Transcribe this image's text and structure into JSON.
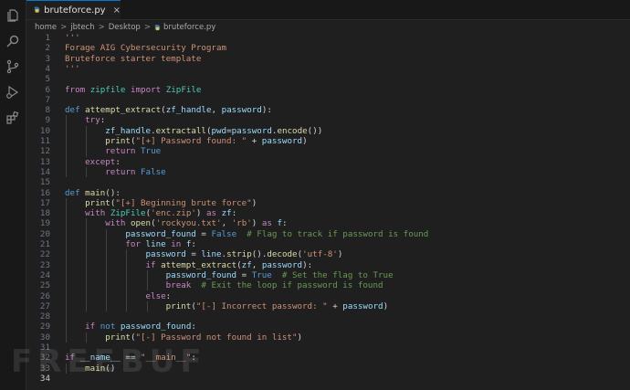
{
  "tab": {
    "label": "bruteforce.py",
    "close": "×"
  },
  "breadcrumb": [
    "home",
    "jbtech",
    "Desktop",
    "bruteforce.py"
  ],
  "breadcrumb_sep": ">",
  "activity_icons": [
    "files-icon",
    "search-icon",
    "source-control-icon",
    "run-debug-icon",
    "extensions-icon"
  ],
  "code_lines": [
    [
      [
        "t-docstr",
        "'''"
      ]
    ],
    [
      [
        "t-docstr",
        "Forage AIG Cybersecurity Program"
      ]
    ],
    [
      [
        "t-docstr",
        "Bruteforce starter template"
      ]
    ],
    [
      [
        "t-docstr",
        "'''"
      ]
    ],
    [],
    [
      [
        "t-kw",
        "from"
      ],
      [
        "t-plain",
        " "
      ],
      [
        "t-cls",
        "zipfile"
      ],
      [
        "t-plain",
        " "
      ],
      [
        "t-kw",
        "import"
      ],
      [
        "t-plain",
        " "
      ],
      [
        "t-cls",
        "ZipFile"
      ]
    ],
    [],
    [
      [
        "t-kw2",
        "def"
      ],
      [
        "t-plain",
        " "
      ],
      [
        "t-fn",
        "attempt_extract"
      ],
      [
        "t-plain",
        "("
      ],
      [
        "t-var",
        "zf_handle"
      ],
      [
        "t-plain",
        ", "
      ],
      [
        "t-var",
        "password"
      ],
      [
        "t-plain",
        "):"
      ]
    ],
    [
      [
        "t-plain",
        "    "
      ],
      [
        "t-kw",
        "try"
      ],
      [
        "t-plain",
        ":"
      ]
    ],
    [
      [
        "t-plain",
        "        "
      ],
      [
        "t-var",
        "zf_handle"
      ],
      [
        "t-plain",
        "."
      ],
      [
        "t-fn",
        "extractall"
      ],
      [
        "t-plain",
        "("
      ],
      [
        "t-var",
        "pwd"
      ],
      [
        "t-plain",
        "="
      ],
      [
        "t-var",
        "password"
      ],
      [
        "t-plain",
        "."
      ],
      [
        "t-fn",
        "encode"
      ],
      [
        "t-plain",
        "())"
      ]
    ],
    [
      [
        "t-plain",
        "        "
      ],
      [
        "t-fn",
        "print"
      ],
      [
        "t-plain",
        "("
      ],
      [
        "t-str",
        "\"[+] Password found: \""
      ],
      [
        "t-plain",
        " + "
      ],
      [
        "t-var",
        "password"
      ],
      [
        "t-plain",
        ")"
      ]
    ],
    [
      [
        "t-plain",
        "        "
      ],
      [
        "t-kw",
        "return"
      ],
      [
        "t-plain",
        " "
      ],
      [
        "t-kw2",
        "True"
      ]
    ],
    [
      [
        "t-plain",
        "    "
      ],
      [
        "t-kw",
        "except"
      ],
      [
        "t-plain",
        ":"
      ]
    ],
    [
      [
        "t-plain",
        "        "
      ],
      [
        "t-kw",
        "return"
      ],
      [
        "t-plain",
        " "
      ],
      [
        "t-kw2",
        "False"
      ]
    ],
    [],
    [
      [
        "t-kw2",
        "def"
      ],
      [
        "t-plain",
        " "
      ],
      [
        "t-fn",
        "main"
      ],
      [
        "t-plain",
        "():"
      ]
    ],
    [
      [
        "t-plain",
        "    "
      ],
      [
        "t-fn",
        "print"
      ],
      [
        "t-plain",
        "("
      ],
      [
        "t-str",
        "\"[+] Beginning brute force\""
      ],
      [
        "t-plain",
        ")"
      ]
    ],
    [
      [
        "t-plain",
        "    "
      ],
      [
        "t-kw",
        "with"
      ],
      [
        "t-plain",
        " "
      ],
      [
        "t-cls",
        "ZipFile"
      ],
      [
        "t-plain",
        "("
      ],
      [
        "t-str",
        "'enc.zip'"
      ],
      [
        "t-plain",
        ") "
      ],
      [
        "t-kw",
        "as"
      ],
      [
        "t-plain",
        " "
      ],
      [
        "t-var",
        "zf"
      ],
      [
        "t-plain",
        ":"
      ]
    ],
    [
      [
        "t-plain",
        "        "
      ],
      [
        "t-kw",
        "with"
      ],
      [
        "t-plain",
        " "
      ],
      [
        "t-fn",
        "open"
      ],
      [
        "t-plain",
        "("
      ],
      [
        "t-str",
        "'rockyou.txt'"
      ],
      [
        "t-plain",
        ", "
      ],
      [
        "t-str",
        "'rb'"
      ],
      [
        "t-plain",
        ") "
      ],
      [
        "t-kw",
        "as"
      ],
      [
        "t-plain",
        " "
      ],
      [
        "t-var",
        "f"
      ],
      [
        "t-plain",
        ":"
      ]
    ],
    [
      [
        "t-plain",
        "            "
      ],
      [
        "t-var",
        "password_found"
      ],
      [
        "t-plain",
        " = "
      ],
      [
        "t-kw2",
        "False"
      ],
      [
        "t-plain",
        "  "
      ],
      [
        "t-com",
        "# Flag to track if password is found"
      ]
    ],
    [
      [
        "t-plain",
        "            "
      ],
      [
        "t-kw",
        "for"
      ],
      [
        "t-plain",
        " "
      ],
      [
        "t-var",
        "line"
      ],
      [
        "t-plain",
        " "
      ],
      [
        "t-kw",
        "in"
      ],
      [
        "t-plain",
        " "
      ],
      [
        "t-var",
        "f"
      ],
      [
        "t-plain",
        ":"
      ]
    ],
    [
      [
        "t-plain",
        "                "
      ],
      [
        "t-var",
        "password"
      ],
      [
        "t-plain",
        " = "
      ],
      [
        "t-var",
        "line"
      ],
      [
        "t-plain",
        "."
      ],
      [
        "t-fn",
        "strip"
      ],
      [
        "t-plain",
        "()."
      ],
      [
        "t-fn",
        "decode"
      ],
      [
        "t-plain",
        "("
      ],
      [
        "t-str",
        "'utf-8'"
      ],
      [
        "t-plain",
        ")"
      ]
    ],
    [
      [
        "t-plain",
        "                "
      ],
      [
        "t-kw",
        "if"
      ],
      [
        "t-plain",
        " "
      ],
      [
        "t-fn",
        "attempt_extract"
      ],
      [
        "t-plain",
        "("
      ],
      [
        "t-var",
        "zf"
      ],
      [
        "t-plain",
        ", "
      ],
      [
        "t-var",
        "password"
      ],
      [
        "t-plain",
        "):"
      ]
    ],
    [
      [
        "t-plain",
        "                    "
      ],
      [
        "t-var",
        "password_found"
      ],
      [
        "t-plain",
        " = "
      ],
      [
        "t-kw2",
        "True"
      ],
      [
        "t-plain",
        "  "
      ],
      [
        "t-com",
        "# Set the flag to True"
      ]
    ],
    [
      [
        "t-plain",
        "                    "
      ],
      [
        "t-kw",
        "break"
      ],
      [
        "t-plain",
        "  "
      ],
      [
        "t-com",
        "# Exit the loop if password is found"
      ]
    ],
    [
      [
        "t-plain",
        "                "
      ],
      [
        "t-kw",
        "else"
      ],
      [
        "t-plain",
        ":"
      ]
    ],
    [
      [
        "t-plain",
        "                    "
      ],
      [
        "t-fn",
        "print"
      ],
      [
        "t-plain",
        "("
      ],
      [
        "t-str",
        "\"[-] Incorrect password: \""
      ],
      [
        "t-plain",
        " + "
      ],
      [
        "t-var",
        "password"
      ],
      [
        "t-plain",
        ")"
      ]
    ],
    [],
    [
      [
        "t-plain",
        "    "
      ],
      [
        "t-kw",
        "if"
      ],
      [
        "t-plain",
        " "
      ],
      [
        "t-kw2",
        "not"
      ],
      [
        "t-plain",
        " "
      ],
      [
        "t-var",
        "password_found"
      ],
      [
        "t-plain",
        ":"
      ]
    ],
    [
      [
        "t-plain",
        "        "
      ],
      [
        "t-fn",
        "print"
      ],
      [
        "t-plain",
        "("
      ],
      [
        "t-str",
        "\"[-] Password not found in list\""
      ],
      [
        "t-plain",
        ")"
      ]
    ],
    [],
    [
      [
        "t-kw",
        "if"
      ],
      [
        "t-plain",
        " "
      ],
      [
        "t-var",
        "__name__"
      ],
      [
        "t-plain",
        " == "
      ],
      [
        "t-str",
        "\"__main__\""
      ],
      [
        "t-plain",
        ":"
      ]
    ],
    [
      [
        "t-plain",
        "    "
      ],
      [
        "t-fn",
        "main"
      ],
      [
        "t-plain",
        "()"
      ]
    ],
    []
  ],
  "active_line": 34,
  "watermark": "FREEBUF"
}
